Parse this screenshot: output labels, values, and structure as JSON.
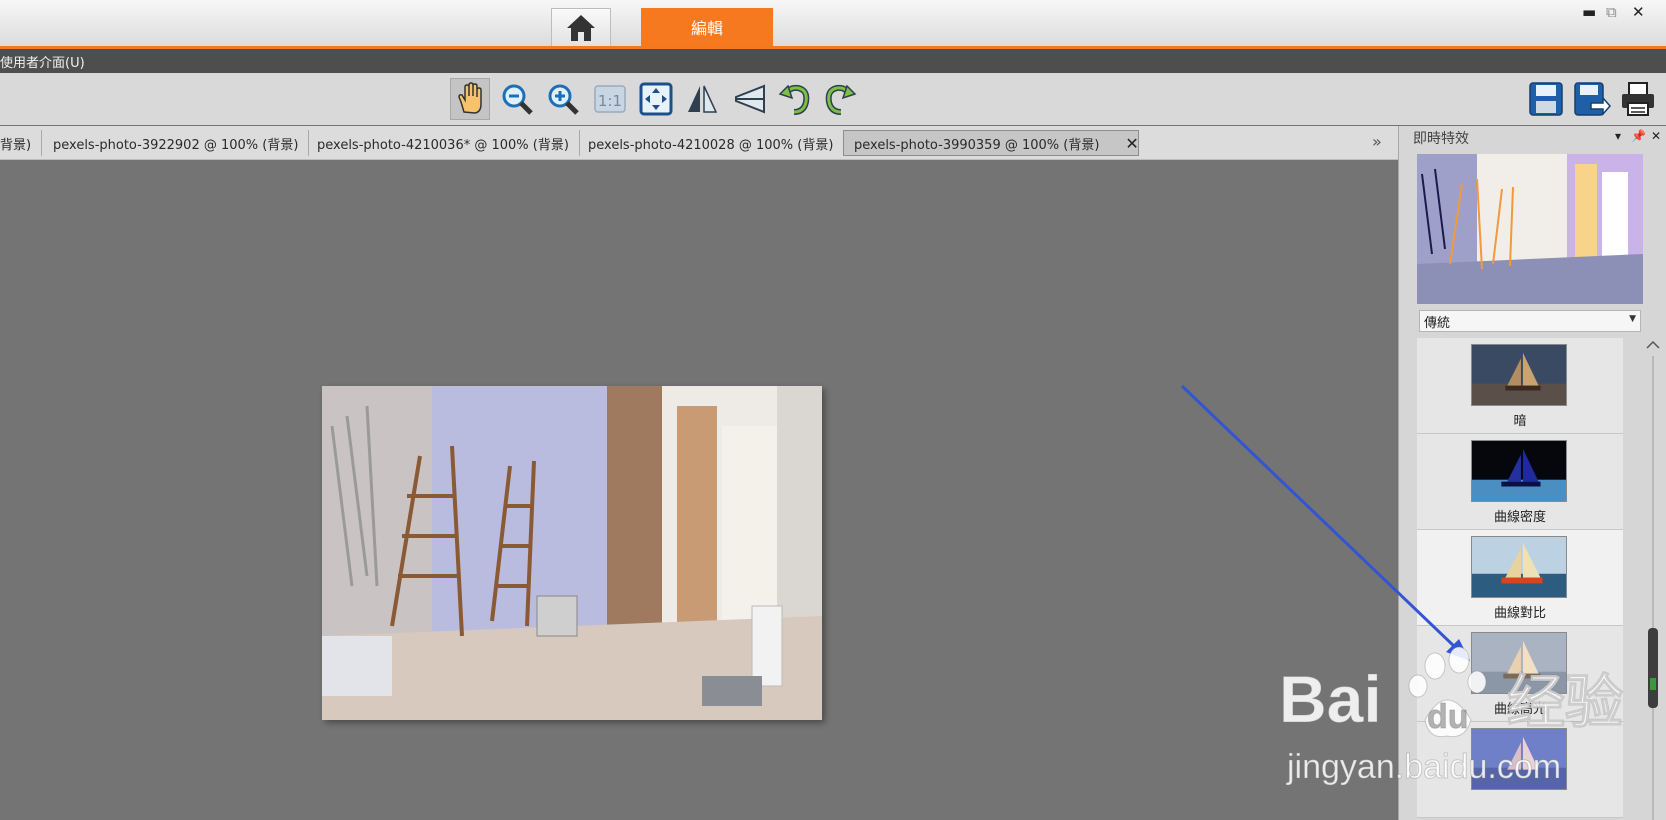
{
  "titlebar": {
    "home_icon": "home-icon",
    "edit_tab": "編輯",
    "window_controls": [
      "minimize-icon",
      "restore-icon",
      "close-icon"
    ]
  },
  "menu": {
    "user_interface": "使用者介面(U)"
  },
  "toolbar": {
    "tools": [
      "hand-icon",
      "zoom-out-icon",
      "zoom-in-icon",
      "actual-size-icon",
      "fit-window-icon",
      "flip-horizontal-icon",
      "flip-vertical-icon",
      "rotate-left-icon",
      "rotate-right-icon"
    ],
    "actual_size_text": "1:1",
    "right_tools": [
      "save-icon",
      "save-as-icon",
      "print-icon"
    ]
  },
  "tabs": [
    {
      "label": "背景)"
    },
    {
      "label": "pexels-photo-3922902 @ 100% (背景)"
    },
    {
      "label": "pexels-photo-4210036* @ 100% (背景)"
    },
    {
      "label": "pexels-photo-4210028 @ 100% (背景)"
    },
    {
      "label": "pexels-photo-3990359 @ 100% (背景)"
    }
  ],
  "tab_close": "✕",
  "tab_scroll": "»",
  "panel": {
    "title": "即時特效",
    "dropdown_value": "傳統",
    "effects": [
      {
        "label": "暗"
      },
      {
        "label": "曲線密度"
      },
      {
        "label": "曲線對比"
      },
      {
        "label": "曲線高光"
      },
      {
        "label": ""
      }
    ]
  },
  "watermark": {
    "brand": "Bai",
    "brand2": "du",
    "brand_cn": "经验",
    "url": "jingyan.baidu.com"
  },
  "colors": {
    "accent": "#f6791f",
    "workspace": "#747474",
    "arrow": "#3355d4"
  }
}
